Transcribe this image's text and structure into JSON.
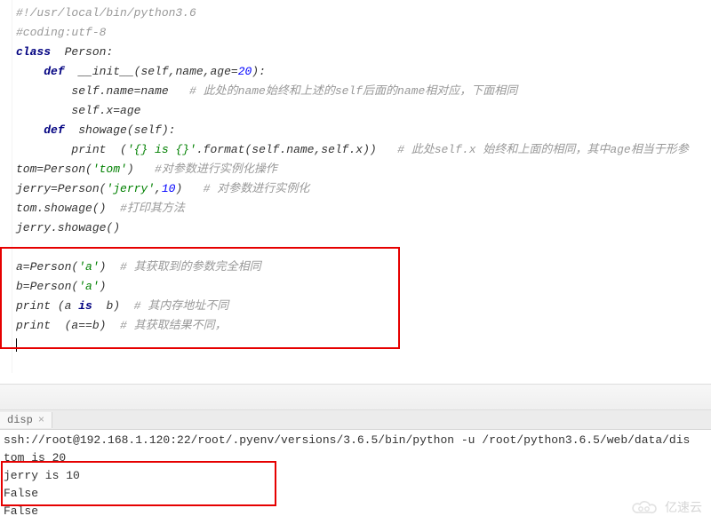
{
  "code": {
    "l1": "#!/usr/local/bin/python3.6",
    "l2": "#coding:utf-8",
    "l3_kw": "class",
    "l3_name": "Person:",
    "l4_kw": "def",
    "l4_name": "__init__",
    "l4_params": "(self,name,age=",
    "l4_default": "20",
    "l4_close": "):",
    "l5_code": "self.name=name",
    "l5_comment": "   # 此处的name始终和上述的self后面的name相对应，下面相同",
    "l6_code": "self.x=age",
    "l7_kw": "def",
    "l7_name": "showage",
    "l7_params": "(self):",
    "l8_print": "print",
    "l8_open": "  (",
    "l8_str": "'{} is {}'",
    "l8_rest": ".format(self.name,self.x))",
    "l8_comment": "   # 此处self.x 始终和上面的相同，其中age相当于形参",
    "l9_code": "tom=Person(",
    "l9_str": "'tom'",
    "l9_close": ")",
    "l9_comment": "   #对参数进行实例化操作",
    "l10_code": "jerry=Person(",
    "l10_str": "'jerry'",
    "l10_mid": ",",
    "l10_num": "10",
    "l10_close": ")",
    "l10_comment": "   # 对参数进行实例化",
    "l11_code": "tom.showage()",
    "l11_comment": "  #打印其方法",
    "l12_code": "jerry.showage()",
    "l14_code": "a=Person(",
    "l14_str": "'a'",
    "l14_close": ")",
    "l14_comment": "  # 其获取到的参数完全相同",
    "l15_code": "b=Person(",
    "l15_str": "'a'",
    "l15_close": ")",
    "l16_print": "print",
    "l16_open": " (a ",
    "l16_is": "is",
    "l16_rest": "  b)",
    "l16_comment": "  # 其内存地址不同",
    "l17_print": "print",
    "l17_rest": "  (a==b)",
    "l17_comment": "  # 其获取结果不同，"
  },
  "tab": {
    "label": "disp",
    "close": "×"
  },
  "console": {
    "cmd": "ssh://root@192.168.1.120:22/root/.pyenv/versions/3.6.5/bin/python -u /root/python3.6.5/web/data/dis",
    "out1": "tom is 20",
    "out2": "jerry is 10",
    "out3": "False",
    "out4": "False"
  },
  "watermark": {
    "text": "亿速云"
  }
}
